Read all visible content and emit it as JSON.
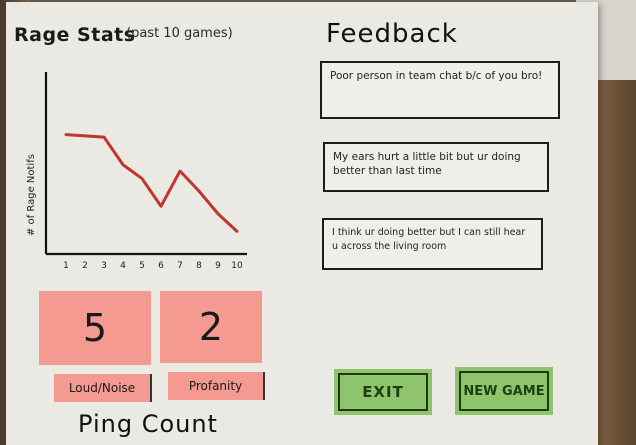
{
  "rage_stats": {
    "title": "Rage Stats",
    "subtitle": "(past 10 games)",
    "chart_data": {
      "type": "line",
      "x": [
        1,
        2,
        3,
        4,
        5,
        6,
        7,
        8,
        9,
        10
      ],
      "y": [
        95,
        94,
        93,
        71,
        60,
        38,
        66,
        50,
        32,
        18
      ],
      "ylabel": "# of Rage Notifs",
      "xlabel": "",
      "ylim": [
        0,
        140
      ],
      "grid": false,
      "series_color": "#c0362c"
    }
  },
  "feedback": {
    "title": "Feedback",
    "items": [
      "Poor person in team chat b/c of you bro!",
      "My ears hurt a little bit but ur doing better than last time",
      "I think ur doing better but I can still hear u across the living room"
    ]
  },
  "ping_count": {
    "title": "Ping Count",
    "loud_noise": {
      "value": "5",
      "label": "Loud/Noise"
    },
    "profanity": {
      "value": "2",
      "label": "Profanity"
    }
  },
  "actions": {
    "exit_label": "EXIT",
    "new_game_label": "NEW GAME"
  },
  "colors": {
    "count_card": "#f49a90",
    "button_green": "#8ec46c"
  }
}
